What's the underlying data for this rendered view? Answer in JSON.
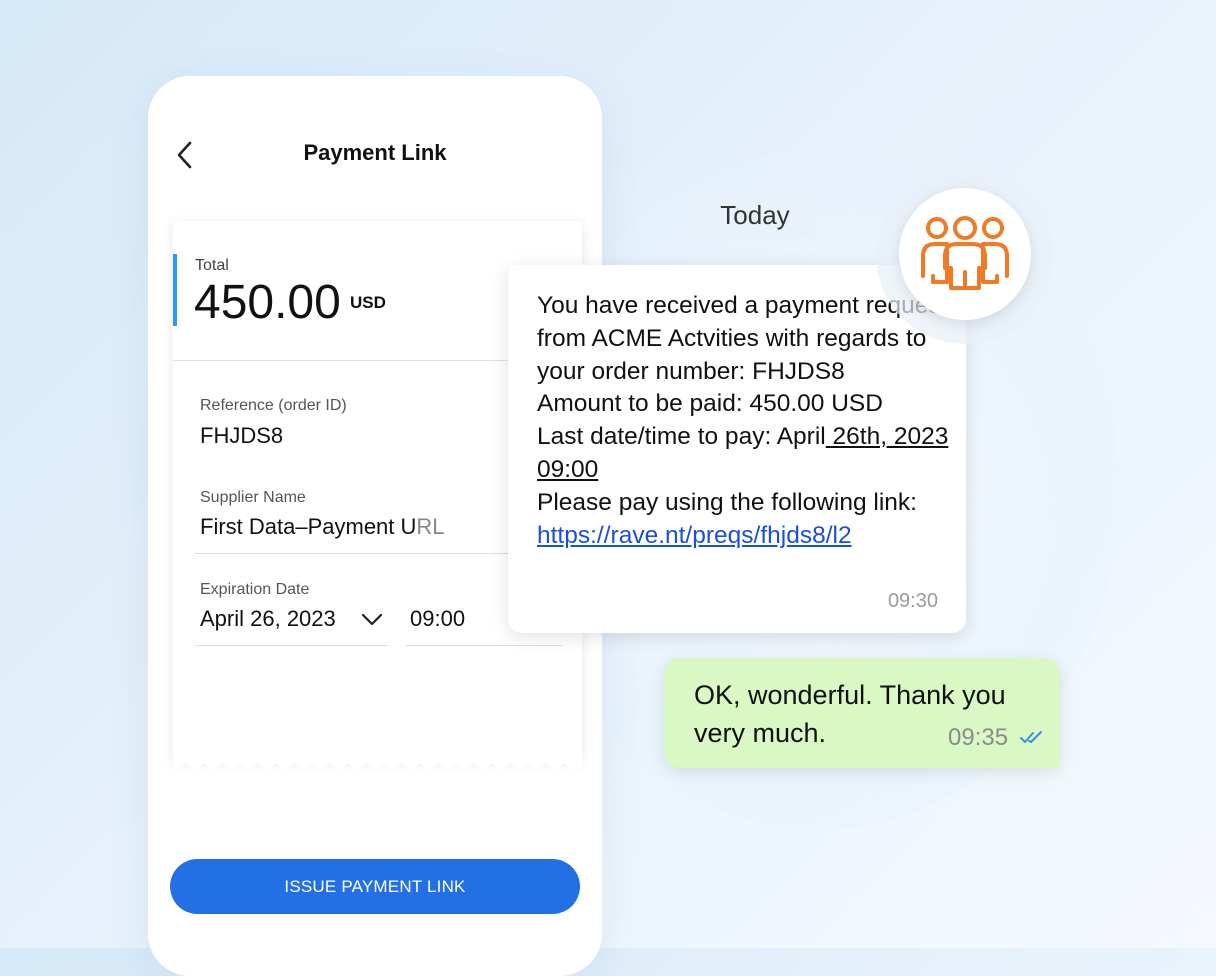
{
  "phone": {
    "title": "Payment Link",
    "total_label": "Total",
    "total_amount": "450.00",
    "total_currency": "USD",
    "reference_label": "Reference (order ID)",
    "reference_value": "FHJDS8",
    "supplier_label": "Supplier Name",
    "supplier_value": "First Data–Payment U",
    "supplier_value_faded": "RL",
    "expiration_label": "Expiration Date",
    "expiration_date": "April 26, 2023",
    "expiration_time": "09:00",
    "issue_button": "ISSUE PAYMENT LINK"
  },
  "chat": {
    "date_separator": "Today",
    "incoming": {
      "line1": "You have received a payment request from ACME Actvities with regards to your order number: FHJDS8",
      "line2": "Amount to be paid: 450.00 USD",
      "line3_prefix": "Last date/time to pay: April",
      "line3_underlined": " 26th, 2023 09:00 ",
      "line4": "Please pay using the following link:",
      "link": "https://rave.nt/preqs/fhjds8/l2",
      "time": "09:30"
    },
    "outgoing": {
      "text": "OK, wonderful. Thank you very much.",
      "time": "09:35",
      "status_icon": "double-check-icon"
    },
    "avatar_icon": "group-users-icon"
  },
  "colors": {
    "accent_blue": "#2370e6",
    "total_bar": "#2c9cf0",
    "avatar_orange": "#f07a26",
    "outgoing_bubble": "#d9f8c4",
    "link": "#1a4fd8"
  }
}
